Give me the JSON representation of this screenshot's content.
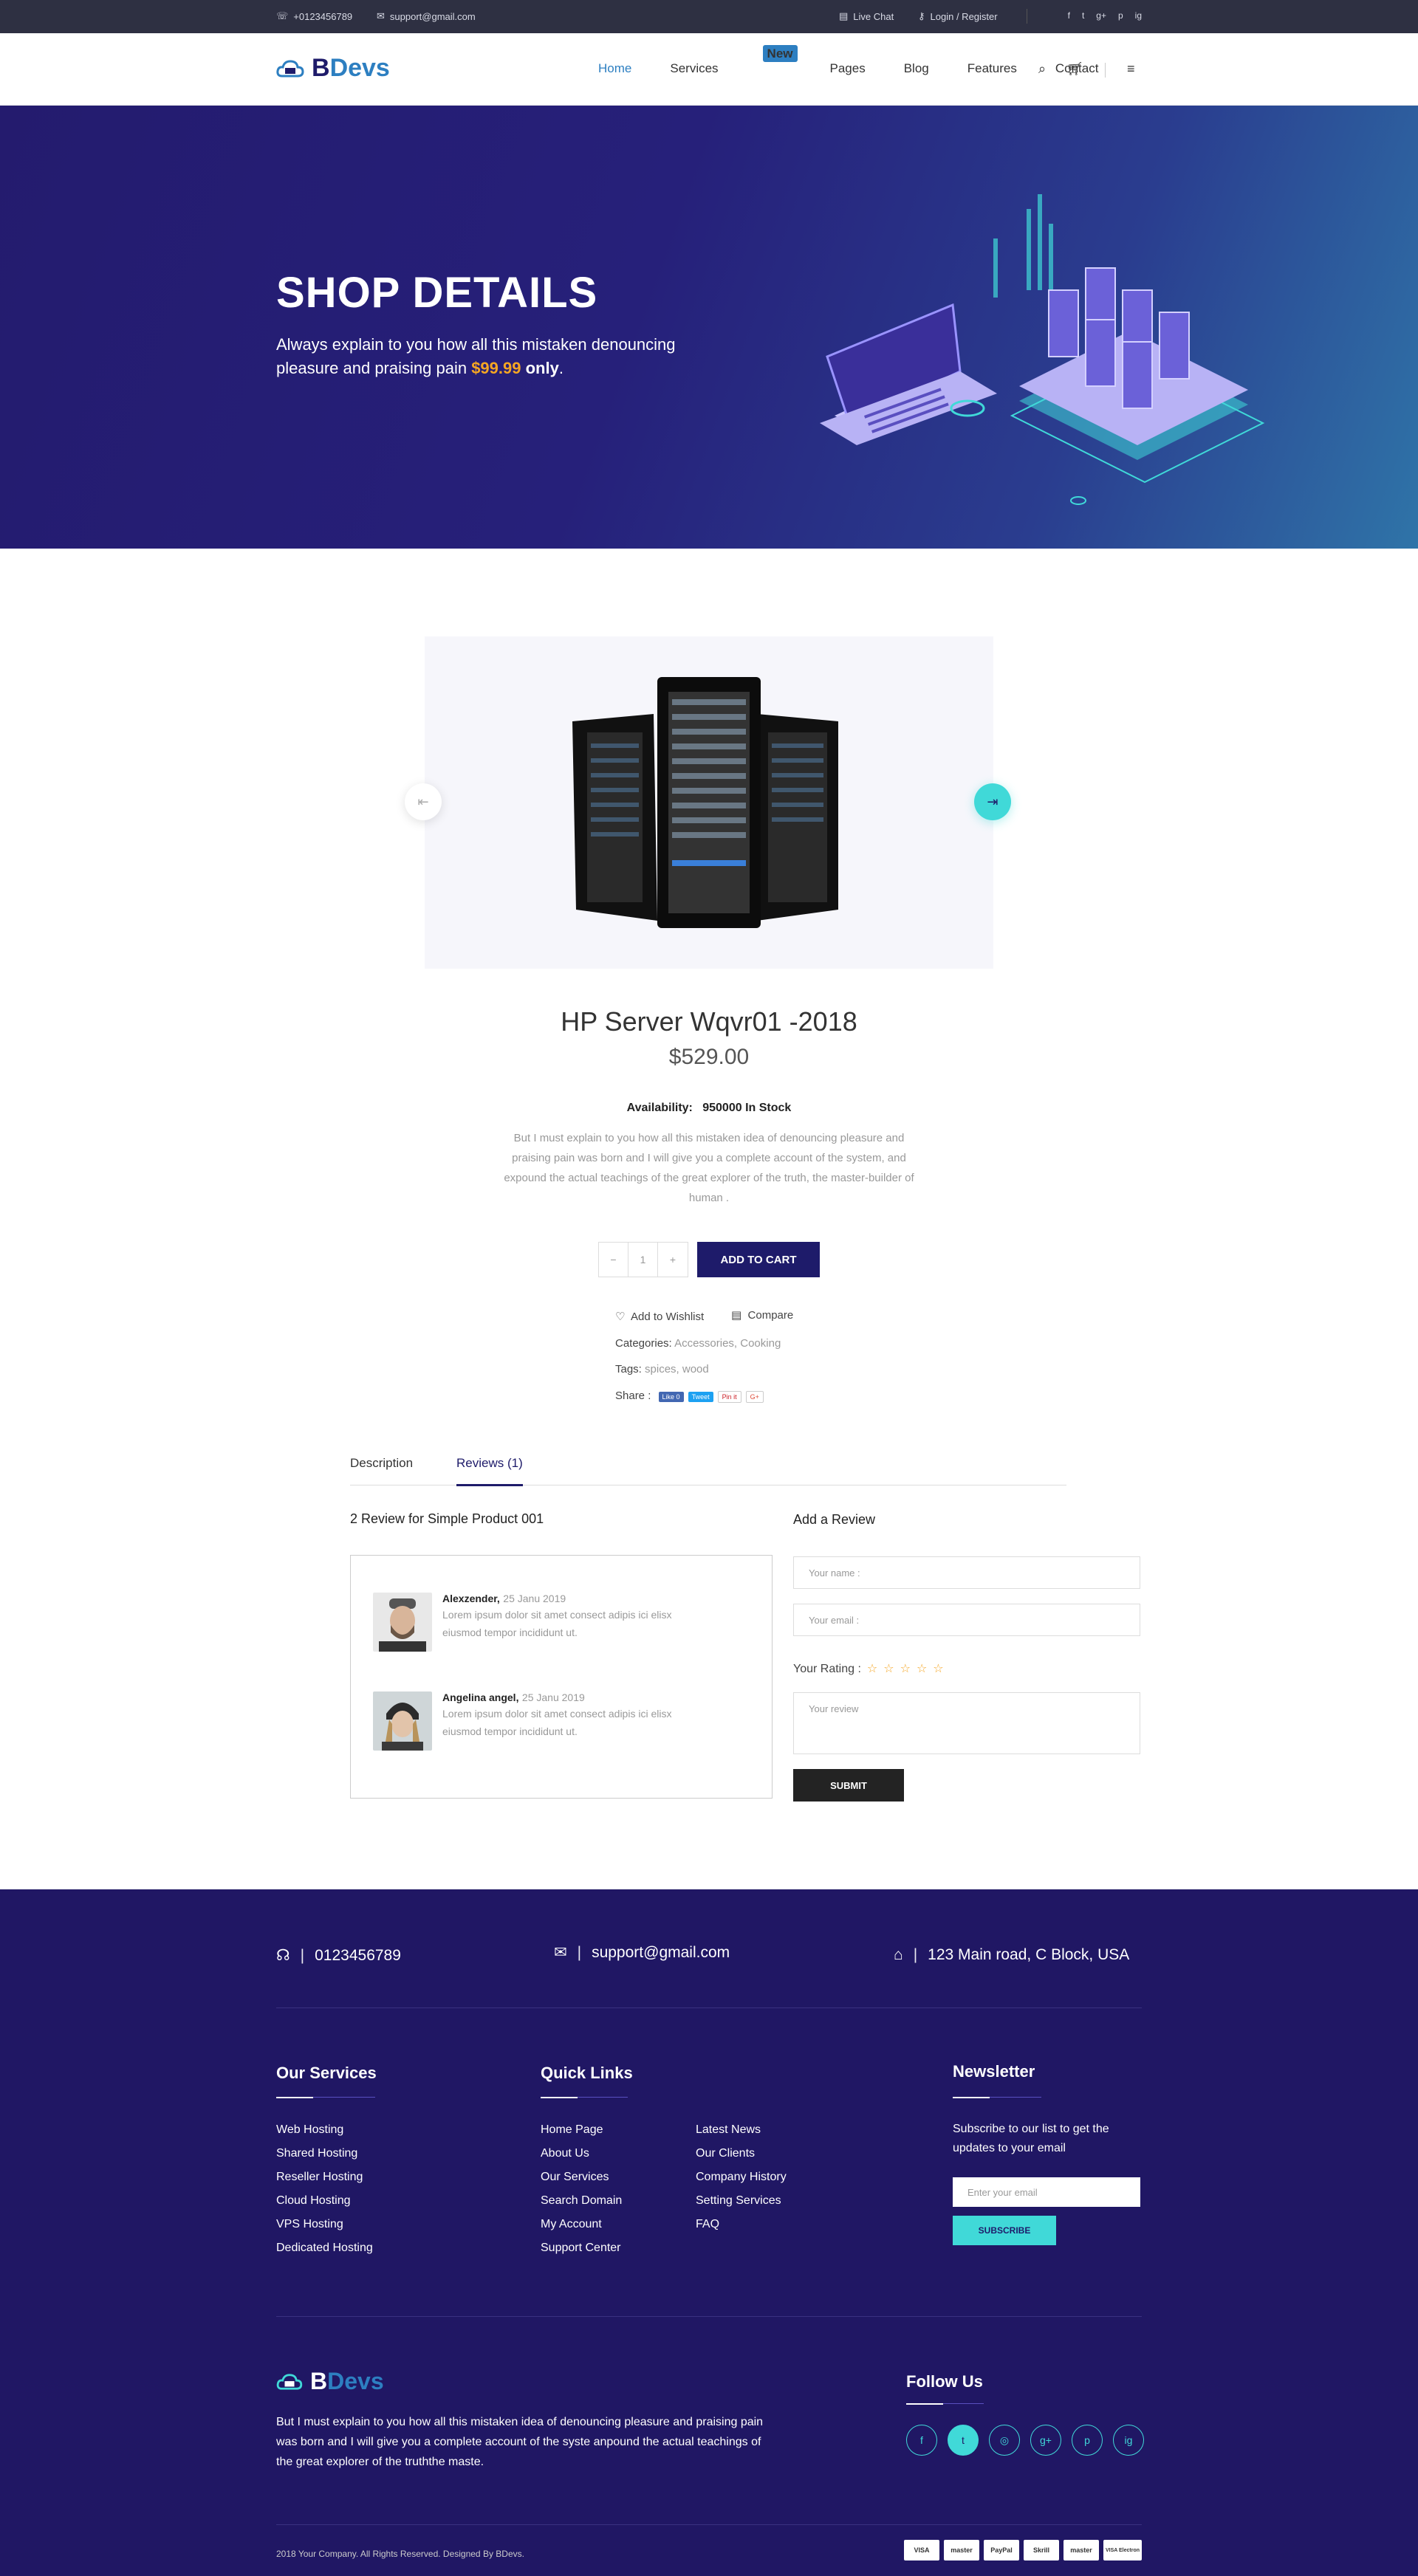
{
  "topbar": {
    "phone": "+0123456789",
    "email": "support@gmail.com",
    "live_chat": "Live Chat",
    "login": "Login / Register",
    "social": [
      "f",
      "t",
      "g+",
      "p",
      "ig"
    ]
  },
  "header": {
    "logo_b": "B",
    "logo_devs": "Devs",
    "nav": [
      "Home",
      "Services",
      "Pages",
      "Blog",
      "Features",
      "Contact"
    ],
    "new_badge": "New"
  },
  "hero": {
    "title": "SHOP DETAILS",
    "line1": "Always explain to you how all this mistaken denouncing pleasure and praising pain ",
    "price": "$99.99",
    "only": "only",
    "dot": "."
  },
  "product": {
    "title": "HP Server Wqvr01 -2018",
    "price": "$529.00",
    "availability_label": "Availability:",
    "availability_value": "950000 In Stock",
    "description": "But I must explain to you how all this mistaken idea of denouncing pleasure and praising pain was born and I will give you a complete account of the system, and expound the actual teachings of the great explorer of the truth, the master-builder of human .",
    "qty_minus": "−",
    "qty_value": "1",
    "qty_plus": "+",
    "add_to_cart": "ADD TO CART",
    "wishlist": "Add to Wishlist",
    "compare": "Compare",
    "categories_label": "Categories:",
    "categories": "Accessories, Cooking",
    "tags_label": "Tags:",
    "tags": "spices, wood",
    "share_label": "Share :",
    "share": [
      "Like 0",
      "Tweet",
      "Pin it",
      "G+"
    ]
  },
  "tabs": {
    "description": "Description",
    "reviews": "Reviews (1)"
  },
  "reviews": {
    "heading": "2 Review for Simple Product 001",
    "items": [
      {
        "name": "Alexzender,",
        "date": "25 Janu 2019",
        "text": "Lorem ipsum dolor sit amet consect adipis ici elisx eiusmod tempor incididunt ut."
      },
      {
        "name": "Angelina angel,",
        "date": "25 Janu 2019",
        "text": "Lorem ipsum dolor sit amet consect adipis ici elisx eiusmod tempor incididunt ut."
      }
    ]
  },
  "review_form": {
    "heading": "Add a Review",
    "name_ph": "Your name :",
    "email_ph": "Your email :",
    "rating_label": "Your Rating :",
    "stars": "☆☆☆☆☆",
    "review_ph": "Your review",
    "submit": "SUBMIT"
  },
  "footer": {
    "phone": "0123456789",
    "email": "support@gmail.com",
    "address": "123 Main road, C Block, USA",
    "sep": "|",
    "services_title": "Our Services",
    "services": [
      "Web Hosting",
      "Shared Hosting",
      "Reseller Hosting",
      "Cloud Hosting",
      "VPS Hosting",
      "Dedicated Hosting"
    ],
    "links_title": "Quick Links",
    "links_col1": [
      "Home Page",
      "About Us",
      "Our Services",
      "Search Domain",
      "My Account",
      "Support Center"
    ],
    "links_col2": [
      "Latest News",
      "Our Clients",
      "Company History",
      "Setting Services",
      "FAQ"
    ],
    "newsletter_title": "Newsletter",
    "newsletter_text": "Subscribe to our list to get the updates to your email",
    "newsletter_ph": "Enter your email",
    "subscribe": "SUBSCRIBE",
    "logo_b": "B",
    "logo_devs": "Devs",
    "about": "But I must explain to you how all this mistaken idea of denouncing pleasure and praising pain was born and I will give you a complete account of the syste anpound the actual teachings of the great explorer of the truththe maste.",
    "follow_title": "Follow Us",
    "follow": [
      "f",
      "t",
      "◎",
      "g+",
      "p",
      "ig"
    ],
    "copyright": "2018 Your Company. All Rights Reserved. Designed By BDevs.",
    "payments": [
      "VISA",
      "master",
      "PayPal",
      "Skrill",
      "master",
      "VISA Electron"
    ]
  },
  "colors": {
    "navy": "#1e1b6a",
    "blue": "#2d7fc1",
    "teal": "#40d9d8",
    "orange": "#f5a623",
    "footer": "#201764"
  }
}
